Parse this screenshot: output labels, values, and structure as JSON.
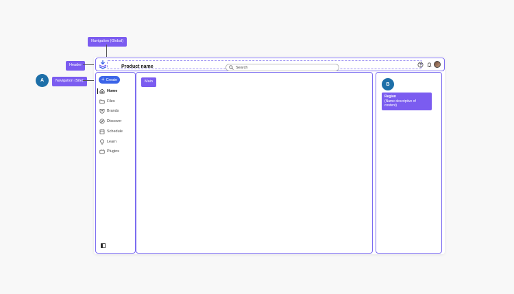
{
  "annotations": {
    "nav_global": "Navigation (Global)",
    "header": "Header",
    "nav_site": "Navigation (Site)",
    "badge_a": "A",
    "badge_b": "B",
    "main": "Main",
    "region_title": "Region",
    "region_desc": "(Name descriptive of content)"
  },
  "header": {
    "product_name": "Product name",
    "search_placeholder": "Search"
  },
  "sidenav": {
    "create_label": "Create",
    "items": [
      {
        "label": "Home",
        "icon": "home-icon",
        "active": true
      },
      {
        "label": "Files",
        "icon": "folder-icon"
      },
      {
        "label": "Brands",
        "icon": "brand-shield-icon"
      },
      {
        "label": "Discover",
        "icon": "compass-icon"
      },
      {
        "label": "Schedule",
        "icon": "calendar-icon"
      },
      {
        "label": "Learn",
        "icon": "lightbulb-icon"
      },
      {
        "label": "Plugins",
        "icon": "plugin-icon"
      }
    ]
  },
  "colors": {
    "accent": "#7b5cf0",
    "outline": "#7b6cf0",
    "create_button": "#3b64e8",
    "badge": "#1d6fa8"
  }
}
